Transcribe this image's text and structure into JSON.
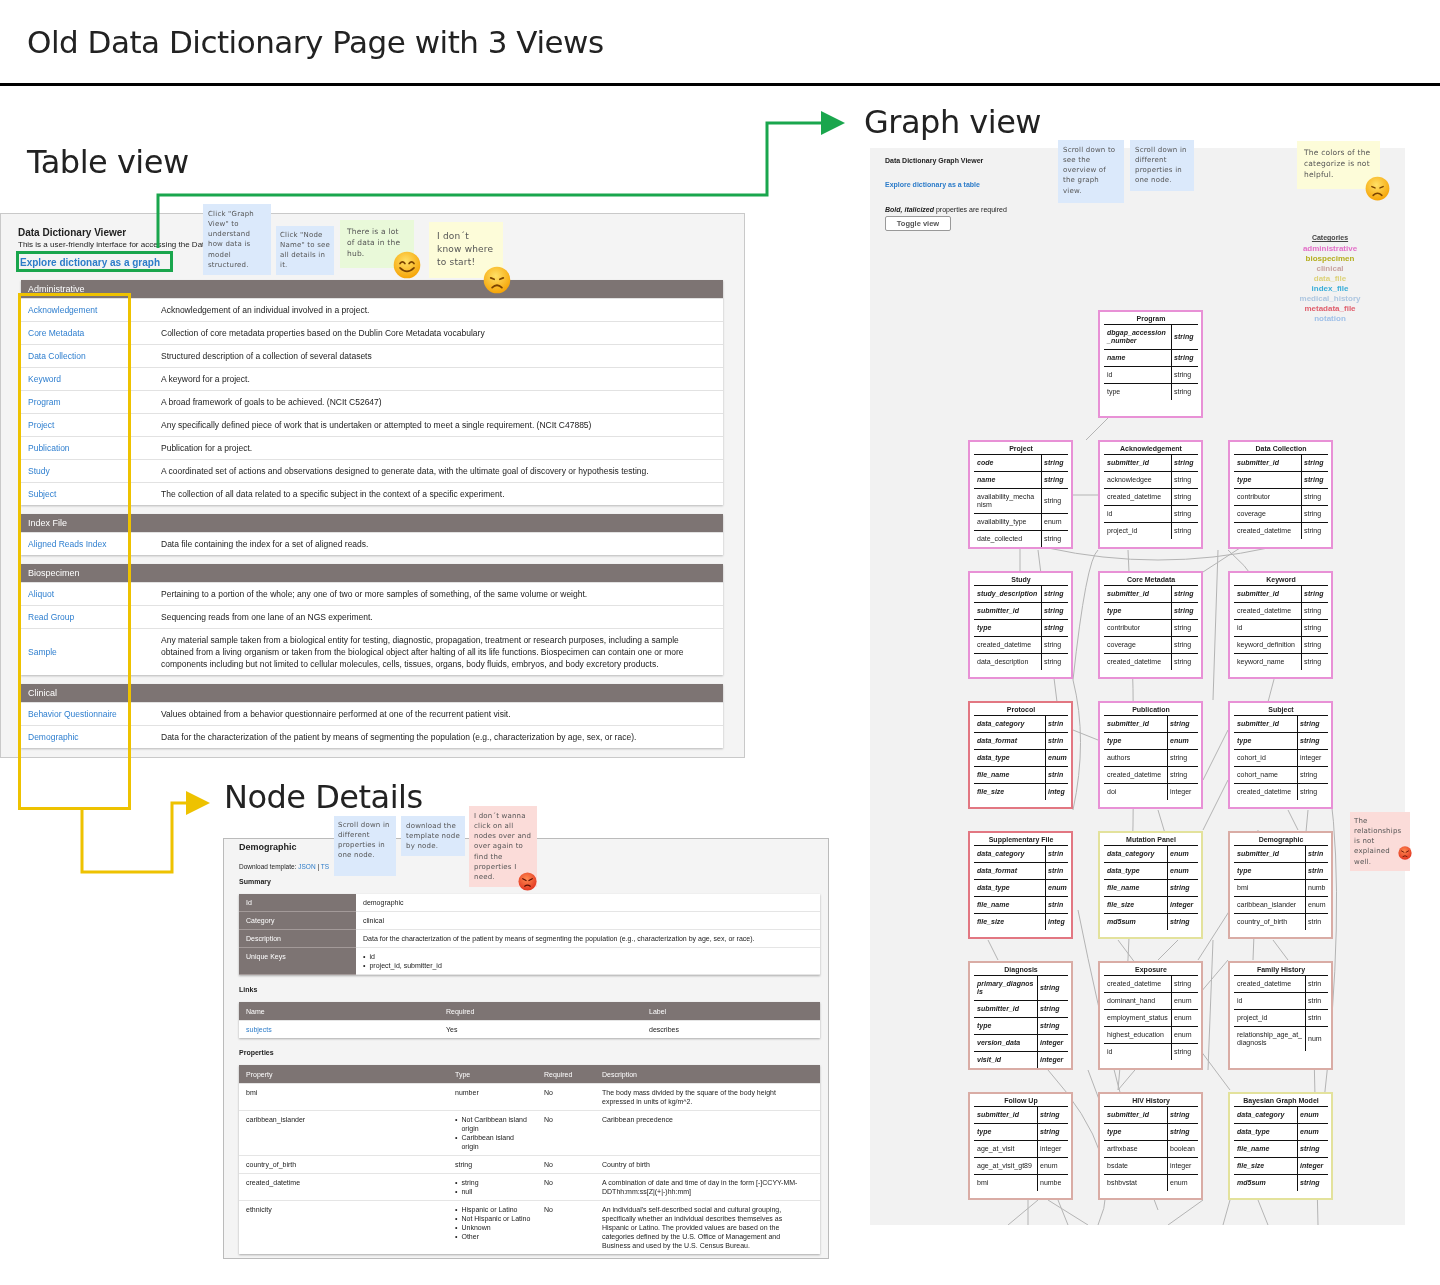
{
  "page_title": "Old Data Dictionary Page with 3 Views",
  "table_view": {
    "heading": "Table view",
    "title": "Data Dictionary Viewer",
    "subtitle": "This is a user-friendly interface for accessing the Dat",
    "graph_link": "Explore dictionary as a graph",
    "categories": [
      {
        "name": "Administrative",
        "nodes": [
          {
            "name": "Acknowledgement",
            "description": "Acknowledgement of an individual involved in a project."
          },
          {
            "name": "Core Metadata",
            "description": "Collection of core metadata properties based on the Dublin Core Metadata vocabulary"
          },
          {
            "name": "Data Collection",
            "description": "Structured description of a collection of several datasets"
          },
          {
            "name": "Keyword",
            "description": "A keyword for a project."
          },
          {
            "name": "Program",
            "description": "A broad framework of goals to be achieved. (NCIt C52647)"
          },
          {
            "name": "Project",
            "description": "Any specifically defined piece of work that is undertaken or attempted to meet a single requirement. (NCIt C47885)"
          },
          {
            "name": "Publication",
            "description": "Publication for a project."
          },
          {
            "name": "Study",
            "description": "A coordinated set of actions and observations designed to generate data, with the ultimate goal of discovery or hypothesis testing."
          },
          {
            "name": "Subject",
            "description": "The collection of all data related to a specific subject in the context of a specific experiment."
          }
        ]
      },
      {
        "name": "Index File",
        "nodes": [
          {
            "name": "Aligned Reads Index",
            "description": "Data file containing the index for a set of aligned reads."
          }
        ]
      },
      {
        "name": "Biospecimen",
        "nodes": [
          {
            "name": "Aliquot",
            "description": "Pertaining to a portion of the whole; any one of two or more samples of something, of the same volume or weight."
          },
          {
            "name": "Read Group",
            "description": "Sequencing reads from one lane of an NGS experiment."
          },
          {
            "name": "Sample",
            "description": "Any material sample taken from a biological entity for testing, diagnostic, propagation, treatment or research purposes, including a sample obtained from a living organism or taken from the biological object after halting of all its life functions. Biospecimen can contain one or more components including but not limited to cellular molecules, cells, tissues, organs, body fluids, embryos, and body excretory products."
          }
        ]
      },
      {
        "name": "Clinical",
        "nodes": [
          {
            "name": "Behavior Questionnaire",
            "description": "Values obtained from a behavior questionnaire performed at one of the recurrent patient visit."
          },
          {
            "name": "Demographic",
            "description": "Data for the characterization of the patient by means of segmenting the population (e.g., characterization by age, sex, or race)."
          }
        ]
      }
    ],
    "notes": [
      {
        "text": "Click \"Graph View\" to understand how data is model structured.",
        "color": "#dbe9fb",
        "kind": "plain"
      },
      {
        "text": "Click \"Node Name\" to see all details in it.",
        "color": "#dbe9fb",
        "kind": "plain"
      },
      {
        "text": "There is a lot of data in the hub.",
        "color": "#e9f9d9",
        "kind": "smile"
      },
      {
        "text": "I don´t know where to start!",
        "color": "#fdfcd9",
        "kind": "sad"
      }
    ]
  },
  "graph_view": {
    "heading": "Graph view",
    "title": "Data Dictionary Graph Viewer",
    "table_link": "Explore dictionary as a table",
    "required_hint": "**Bold, italicized** properties are required",
    "toggle_button": "Toggle view",
    "legend": {
      "title": "Categories",
      "items": [
        {
          "name": "administrative",
          "color": "#e36fc8"
        },
        {
          "name": "biospecimen",
          "color": "#b5ae1e"
        },
        {
          "name": "clinical",
          "color": "#c9a3a0"
        },
        {
          "name": "data_file",
          "color": "#ddd27a"
        },
        {
          "name": "index_file",
          "color": "#3aaed8"
        },
        {
          "name": "medical_history",
          "color": "#adc6e0"
        },
        {
          "name": "metadata_file",
          "color": "#e0606e"
        },
        {
          "name": "notation",
          "color": "#9fc0e8"
        }
      ]
    },
    "root_node": {
      "title": "Program",
      "color": "#e891d6",
      "props": [
        {
          "name": "dbgap_accession_number",
          "type": "string",
          "required": true
        },
        {
          "name": "name",
          "type": "string",
          "required": true
        },
        {
          "name": "id",
          "type": "string",
          "required": false
        },
        {
          "name": "type",
          "type": "string",
          "required": false
        }
      ]
    },
    "nodes": [
      {
        "title": "Project",
        "color": "#e891d6",
        "props": [
          {
            "name": "code",
            "type": "string",
            "required": true
          },
          {
            "name": "name",
            "type": "string",
            "required": true
          },
          {
            "name": "availability_mechanism",
            "type": "string",
            "required": false
          },
          {
            "name": "availability_type",
            "type": "enum",
            "required": false
          },
          {
            "name": "date_collected",
            "type": "string",
            "required": false
          }
        ]
      },
      {
        "title": "Acknowledgement",
        "color": "#e891d6",
        "props": [
          {
            "name": "submitter_id",
            "type": "string",
            "required": true
          },
          {
            "name": "acknowledgee",
            "type": "string",
            "required": false
          },
          {
            "name": "created_datetime",
            "type": "string",
            "required": false
          },
          {
            "name": "id",
            "type": "string",
            "required": false
          },
          {
            "name": "project_id",
            "type": "string",
            "required": false
          }
        ]
      },
      {
        "title": "Data Collection",
        "color": "#e891d6",
        "props": [
          {
            "name": "submitter_id",
            "type": "string",
            "required": true
          },
          {
            "name": "type",
            "type": "string",
            "required": true
          },
          {
            "name": "contributor",
            "type": "string",
            "required": false
          },
          {
            "name": "coverage",
            "type": "string",
            "required": false
          },
          {
            "name": "created_datetime",
            "type": "string",
            "required": false
          }
        ]
      },
      {
        "title": "Study",
        "color": "#e891d6",
        "props": [
          {
            "name": "study_description",
            "type": "string",
            "required": true
          },
          {
            "name": "submitter_id",
            "type": "string",
            "required": true
          },
          {
            "name": "type",
            "type": "string",
            "required": true
          },
          {
            "name": "created_datetime",
            "type": "string",
            "required": false
          },
          {
            "name": "data_description",
            "type": "string",
            "required": false
          }
        ]
      },
      {
        "title": "Core Metadata",
        "color": "#e891d6",
        "props": [
          {
            "name": "submitter_id",
            "type": "string",
            "required": true
          },
          {
            "name": "type",
            "type": "string",
            "required": true
          },
          {
            "name": "contributor",
            "type": "string",
            "required": false
          },
          {
            "name": "coverage",
            "type": "string",
            "required": false
          },
          {
            "name": "created_datetime",
            "type": "string",
            "required": false
          }
        ]
      },
      {
        "title": "Keyword",
        "color": "#e891d6",
        "props": [
          {
            "name": "submitter_id",
            "type": "string",
            "required": true
          },
          {
            "name": "created_datetime",
            "type": "string",
            "required": false
          },
          {
            "name": "id",
            "type": "string",
            "required": false
          },
          {
            "name": "keyword_definition",
            "type": "string",
            "required": false
          },
          {
            "name": "keyword_name",
            "type": "string",
            "required": false
          }
        ]
      },
      {
        "title": "Protocol",
        "color": "#e27782",
        "props": [
          {
            "name": "data_category",
            "type": "strin",
            "required": true
          },
          {
            "name": "data_format",
            "type": "strin",
            "required": true
          },
          {
            "name": "data_type",
            "type": "enum",
            "required": true
          },
          {
            "name": "file_name",
            "type": "strin",
            "required": true
          },
          {
            "name": "file_size",
            "type": "integ",
            "required": true
          }
        ]
      },
      {
        "title": "Publication",
        "color": "#e891d6",
        "props": [
          {
            "name": "submitter_id",
            "type": "string",
            "required": true
          },
          {
            "name": "type",
            "type": "enum",
            "required": true
          },
          {
            "name": "authors",
            "type": "string",
            "required": false
          },
          {
            "name": "created_datetime",
            "type": "string",
            "required": false
          },
          {
            "name": "doi",
            "type": "integer",
            "required": false
          }
        ]
      },
      {
        "title": "Subject",
        "color": "#e891d6",
        "props": [
          {
            "name": "submitter_id",
            "type": "string",
            "required": true
          },
          {
            "name": "type",
            "type": "string",
            "required": true
          },
          {
            "name": "cohort_id",
            "type": "integer",
            "required": false
          },
          {
            "name": "cohort_name",
            "type": "string",
            "required": false
          },
          {
            "name": "created_datetime",
            "type": "string",
            "required": false
          }
        ]
      },
      {
        "title": "Supplementary File",
        "color": "#e27782",
        "props": [
          {
            "name": "data_category",
            "type": "strin",
            "required": true
          },
          {
            "name": "data_format",
            "type": "strin",
            "required": true
          },
          {
            "name": "data_type",
            "type": "enum",
            "required": true
          },
          {
            "name": "file_name",
            "type": "strin",
            "required": true
          },
          {
            "name": "file_size",
            "type": "integ",
            "required": true
          }
        ]
      },
      {
        "title": "Mutation Panel",
        "color": "#e3e29c",
        "props": [
          {
            "name": "data_category",
            "type": "enum",
            "required": true
          },
          {
            "name": "data_type",
            "type": "enum",
            "required": true
          },
          {
            "name": "file_name",
            "type": "string",
            "required": true
          },
          {
            "name": "file_size",
            "type": "integer",
            "required": true
          },
          {
            "name": "md5sum",
            "type": "string",
            "required": true
          }
        ]
      },
      {
        "title": "Demographic",
        "color": "#d9aca5",
        "props": [
          {
            "name": "submitter_id",
            "type": "strin",
            "required": true
          },
          {
            "name": "type",
            "type": "strin",
            "required": true
          },
          {
            "name": "bmi",
            "type": "numb",
            "required": false
          },
          {
            "name": "caribbean_islander",
            "type": "enum",
            "required": false
          },
          {
            "name": "country_of_birth",
            "type": "strin",
            "required": false
          }
        ]
      },
      {
        "title": "Diagnosis",
        "color": "#d9aca5",
        "props": [
          {
            "name": "primary_diagnosis",
            "type": "string",
            "required": true
          },
          {
            "name": "submitter_id",
            "type": "string",
            "required": true
          },
          {
            "name": "type",
            "type": "string",
            "required": true
          },
          {
            "name": "version_data",
            "type": "integer",
            "required": true
          },
          {
            "name": "visit_id",
            "type": "integer",
            "required": true
          }
        ]
      },
      {
        "title": "Exposure",
        "color": "#d9aca5",
        "props": [
          {
            "name": "created_datetime",
            "type": "string",
            "required": false
          },
          {
            "name": "dominant_hand",
            "type": "enum",
            "required": false
          },
          {
            "name": "employment_status",
            "type": "enum",
            "required": false
          },
          {
            "name": "highest_education",
            "type": "enum",
            "required": false
          },
          {
            "name": "id",
            "type": "string",
            "required": false
          }
        ]
      },
      {
        "title": "Family History",
        "color": "#d9aca5",
        "props": [
          {
            "name": "created_datetime",
            "type": "strin",
            "required": false
          },
          {
            "name": "id",
            "type": "strin",
            "required": false
          },
          {
            "name": "project_id",
            "type": "strin",
            "required": false
          },
          {
            "name": "relationship_age_at_diagnosis",
            "type": "num",
            "required": false
          }
        ]
      },
      {
        "title": "Follow Up",
        "color": "#d9aca5",
        "props": [
          {
            "name": "submitter_id",
            "type": "string",
            "required": true
          },
          {
            "name": "type",
            "type": "string",
            "required": true
          },
          {
            "name": "age_at_visit",
            "type": "integer",
            "required": false
          },
          {
            "name": "age_at_visit_gt89",
            "type": "enum",
            "required": false
          },
          {
            "name": "bmi",
            "type": "numbe",
            "required": false
          }
        ]
      },
      {
        "title": "HIV History",
        "color": "#d9aca5",
        "props": [
          {
            "name": "submitter_id",
            "type": "string",
            "required": true
          },
          {
            "name": "type",
            "type": "string",
            "required": true
          },
          {
            "name": "arthxbase",
            "type": "boolean",
            "required": false
          },
          {
            "name": "bsdate",
            "type": "integer",
            "required": false
          },
          {
            "name": "bshbvstat",
            "type": "enum",
            "required": false
          }
        ]
      },
      {
        "title": "Bayesian Graph Model",
        "color": "#e3e29c",
        "props": [
          {
            "name": "data_category",
            "type": "enum",
            "required": true
          },
          {
            "name": "data_type",
            "type": "enum",
            "required": true
          },
          {
            "name": "file_name",
            "type": "string",
            "required": true
          },
          {
            "name": "file_size",
            "type": "integer",
            "required": true
          },
          {
            "name": "md5sum",
            "type": "string",
            "required": true
          }
        ]
      }
    ],
    "notes": [
      {
        "text": "Scroll down to see the overview of the graph view.",
        "color": "#dbe9fb",
        "kind": "plain"
      },
      {
        "text": "Scroll down in different properties in one node.",
        "color": "#dbe9fb",
        "kind": "plain"
      },
      {
        "text": "The colors of the categorize is not helpful.",
        "color": "#fdfcd9",
        "kind": "sad"
      },
      {
        "text": "The relationships is not explained well.",
        "color": "#fbdcd9",
        "kind": "angry"
      }
    ]
  },
  "node_details": {
    "heading": "Node Details",
    "title": "Demographic",
    "download_label": "Download template:",
    "download_links": [
      "JSON",
      "TS"
    ],
    "download_separator": "|",
    "bullet": "•",
    "summary_label": "Summary",
    "summary": [
      {
        "key": "Id",
        "kind": "text",
        "values": [
          "demographic"
        ]
      },
      {
        "key": "Category",
        "kind": "text",
        "values": [
          "clinical"
        ]
      },
      {
        "key": "Description",
        "kind": "text",
        "values": [
          "Data for the characterization of the patient by means of segmenting the population (e.g., characterization by age, sex, or race)."
        ]
      },
      {
        "key": "Unique Keys",
        "kind": "list",
        "values": [
          "id",
          "project_id, submitter_id"
        ]
      }
    ],
    "links_label": "Links",
    "links_columns": [
      "Name",
      "Required",
      "Label"
    ],
    "links": [
      {
        "name": "subjects",
        "required": "Yes",
        "label": "describes"
      }
    ],
    "properties_label": "Properties",
    "properties_columns": [
      "Property",
      "Type",
      "Required",
      "Description"
    ],
    "properties": [
      {
        "property": "bmi",
        "type": [
          "number"
        ],
        "required": "No",
        "description": "The body mass divided by the square of the body height expressed in units of kg/m^2."
      },
      {
        "property": "caribbean_islander",
        "type": [
          "Not Caribbean island origin",
          "Caribbean island origin"
        ],
        "required": "No",
        "description": "Caribbean precedence"
      },
      {
        "property": "country_of_birth",
        "type": [
          "string"
        ],
        "required": "No",
        "description": "Country of birth"
      },
      {
        "property": "created_datetime",
        "type": [
          "string",
          "null"
        ],
        "required": "No",
        "description": "A combination of date and time of day in the form [-]CCYY-MM-DDThh:mm:ss[Z|(+|-)hh:mm]"
      },
      {
        "property": "ethnicity",
        "type": [
          "Hispanic or Latino",
          "Not Hispanic or Latino",
          "Unknown",
          "Other"
        ],
        "required": "No",
        "description": "An individual's self-described social and cultural grouping, specifically whether an individual describes themselves as Hispanic or Latino. The provided values are based on the categories defined by the U.S. Office of Management and Business and used by the U.S. Census Bureau."
      }
    ],
    "notes": [
      {
        "text": "Scroll down in different properties in one node.",
        "color": "#dbe9fb",
        "kind": "plain"
      },
      {
        "text": "download the template node by node.",
        "color": "#dbe9fb",
        "kind": "plain"
      },
      {
        "text": "I don´t wanna click on all nodes over and over again to find the properties I need.",
        "color": "#fbdcd9",
        "kind": "angry"
      }
    ]
  }
}
